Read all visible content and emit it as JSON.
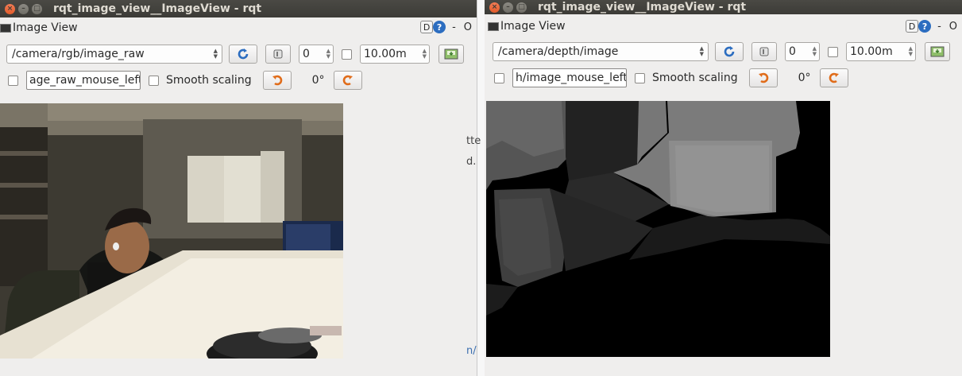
{
  "left": {
    "title": "rqt_image_view__ImageView - rqt",
    "panel_label": "Image View",
    "d_label": "D",
    "help_label": "?",
    "dash_label": "-",
    "circle_label": "O",
    "topic": "/camera/rgb/image_raw",
    "spin_value": "0",
    "distance_value": "10.00m",
    "mouse_topic": "age_raw_mouse_left",
    "smooth_label": "Smooth scaling",
    "rotation": "0°"
  },
  "right": {
    "title": "rqt_image_view__ImageView - rqt",
    "panel_label": "Image View",
    "d_label": "D",
    "help_label": "?",
    "dash_label": "-",
    "circle_label": "O",
    "topic": "/camera/depth/image",
    "spin_value": "0",
    "distance_value": "10.00m",
    "mouse_topic": "h/image_mouse_left",
    "smooth_label": "Smooth scaling",
    "rotation": "0°"
  },
  "peek_text": [
    "tte",
    "d.",
    "n/"
  ],
  "colors": {
    "titlebar": "#3c3b37",
    "close_button": "#e35c2b",
    "refresh_blue": "#2c6dc0",
    "rotate_orange": "#e06c1a"
  },
  "icons": {
    "refresh": "refresh-icon",
    "pause": "pause-icon",
    "save": "save-icon",
    "rotate_left": "rotate-left-icon",
    "rotate_right": "rotate-right-icon"
  }
}
